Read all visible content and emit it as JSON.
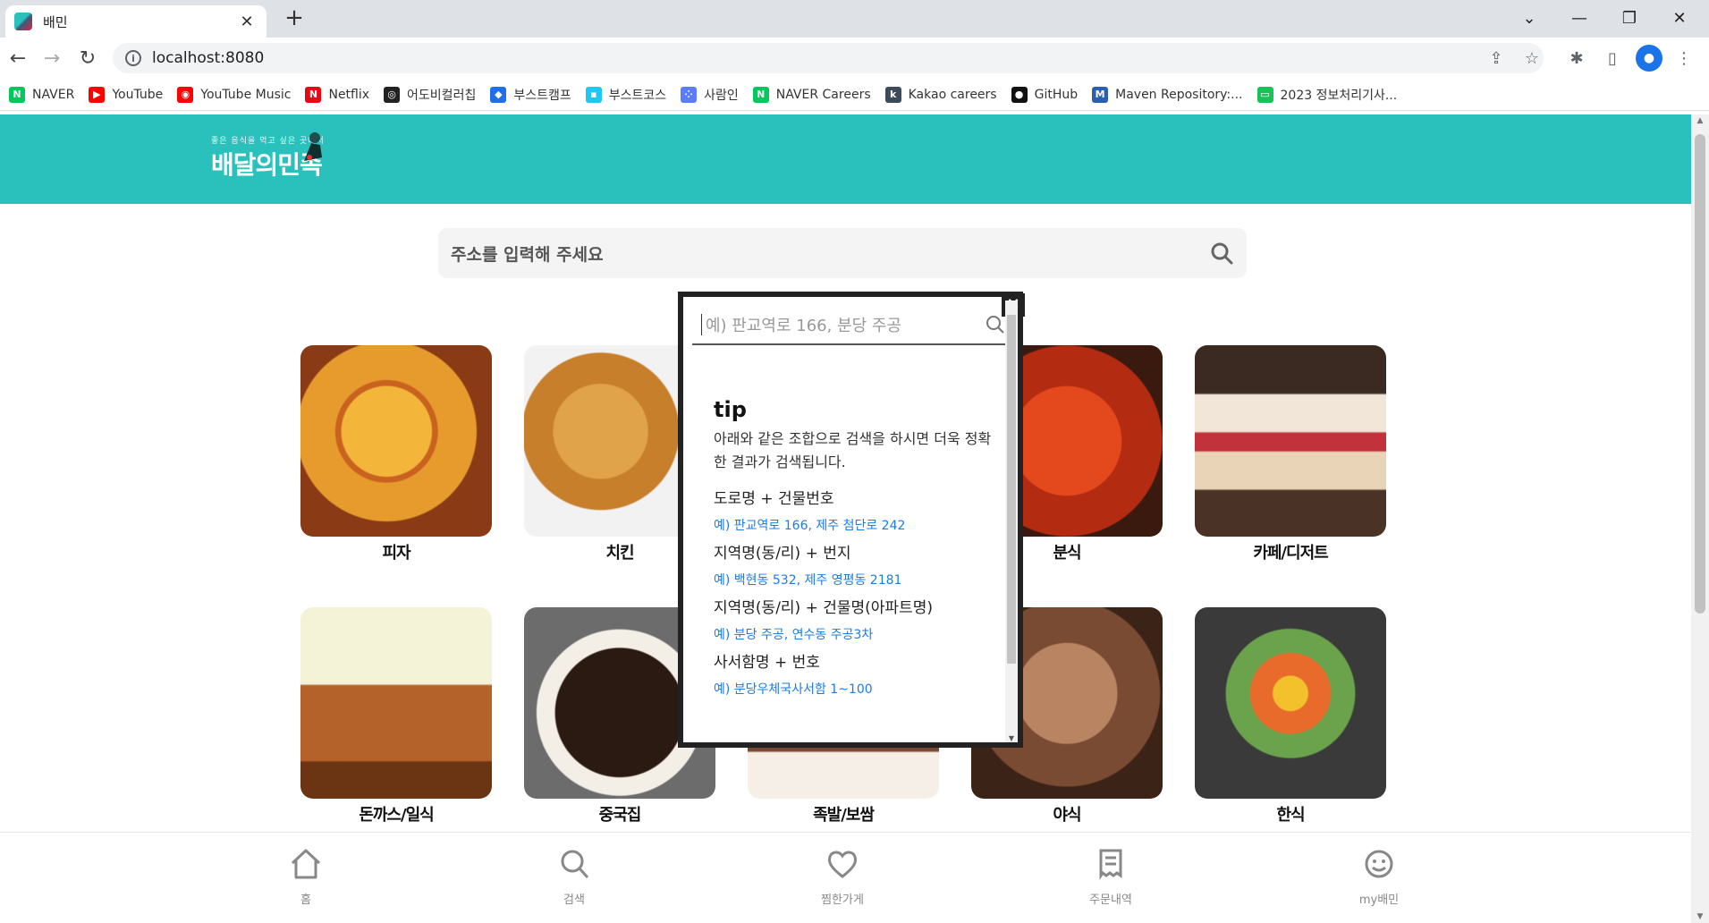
{
  "browser": {
    "tab_title": "배민",
    "url": "localhost:8080",
    "bookmarks": [
      {
        "label": "NAVER",
        "icon": "naver-icon",
        "color": "#03c75a",
        "glyph": "N"
      },
      {
        "label": "YouTube",
        "icon": "youtube-icon",
        "color": "#ff0000",
        "glyph": "▶"
      },
      {
        "label": "YouTube Music",
        "icon": "youtube-music-icon",
        "color": "#ff0000",
        "glyph": "◉"
      },
      {
        "label": "Netflix",
        "icon": "netflix-icon",
        "color": "#e50914",
        "glyph": "N"
      },
      {
        "label": "어도비컬러칩",
        "icon": "adobe-color-icon",
        "color": "#222222",
        "glyph": "◎"
      },
      {
        "label": "부스트캠프",
        "icon": "boostcamp-icon",
        "color": "#1f6feb",
        "glyph": "◆"
      },
      {
        "label": "부스트코스",
        "icon": "boostcourse-icon",
        "color": "#1ec8f0",
        "glyph": "▪"
      },
      {
        "label": "사람인",
        "icon": "saramin-icon",
        "color": "#5a7dff",
        "glyph": "⁘"
      },
      {
        "label": "NAVER Careers",
        "icon": "naver-careers-icon",
        "color": "#03c75a",
        "glyph": "N"
      },
      {
        "label": "Kakao careers",
        "icon": "kakao-careers-icon",
        "color": "#3c4a5c",
        "glyph": "k"
      },
      {
        "label": "GitHub",
        "icon": "github-icon",
        "color": "#111111",
        "glyph": "●"
      },
      {
        "label": "Maven Repository:...",
        "icon": "maven-icon",
        "color": "#2b5fb4",
        "glyph": "M"
      },
      {
        "label": "2023 정보처리기사...",
        "icon": "exam-icon",
        "color": "#19c159",
        "glyph": "▭"
      }
    ]
  },
  "page": {
    "brand_slogan": "좋은 음식을 먹고 싶은 곳에서",
    "brand_name": "배달의민족",
    "search_placeholder": "주소를 입력해 주세요",
    "categories": [
      {
        "label": "피자",
        "icon": "pizza"
      },
      {
        "label": "치킨",
        "icon": "chicken"
      },
      {
        "label": "분식",
        "icon": "tteokbokki"
      },
      {
        "label": "카페/디저트",
        "icon": "cake"
      },
      {
        "label": "돈까스/일식",
        "icon": "tonkatsu"
      },
      {
        "label": "중국집",
        "icon": "jajangmyeon"
      },
      {
        "label": "족발/보쌈",
        "icon": "jokbal"
      },
      {
        "label": "야식",
        "icon": "night-snack"
      },
      {
        "label": "한식",
        "icon": "bibimbap"
      }
    ],
    "footer_nav": [
      {
        "label": "홈",
        "icon": "home-icon"
      },
      {
        "label": "검색",
        "icon": "search-icon"
      },
      {
        "label": "찜한가게",
        "icon": "heart-icon"
      },
      {
        "label": "주문내역",
        "icon": "receipt-icon"
      },
      {
        "label": "my배민",
        "icon": "smile-icon"
      }
    ]
  },
  "popup": {
    "close_label": "×",
    "placeholder": "예) 판교역로 166, 분당 주공",
    "tip_title": "tip",
    "tip_desc": "아래와 같은 조합으로 검색을 하시면 더욱 정확한 결과가 검색됩니다.",
    "rules": [
      {
        "rule": "도로명 + 건물번호",
        "example": "예) 판교역로 166,  제주 첨단로 242"
      },
      {
        "rule": "지역명(동/리) + 번지",
        "example": "예) 백현동 532,  제주 영평동 2181"
      },
      {
        "rule": "지역명(동/리) + 건물명(아파트명)",
        "example": "예) 분당 주공,  연수동 주공3차"
      },
      {
        "rule": "사서함명 + 번호",
        "example": "예) 분당우체국사서함 1~100"
      }
    ]
  },
  "colors": {
    "brand": "#2ac1bc",
    "link": "#1e7be0"
  }
}
